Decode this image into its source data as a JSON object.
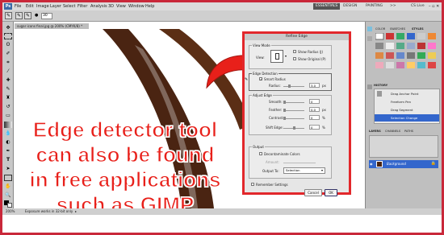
{
  "menubar": {
    "logo": "Ps",
    "items": [
      "File",
      "Edit",
      "Image",
      "Layer",
      "Select",
      "Filter",
      "Analysis",
      "3D",
      "View",
      "Window",
      "Help"
    ],
    "workspaces": [
      "ESSENTIALS",
      "DESIGN",
      "PAINTING",
      ">>"
    ],
    "cs_live": "CS Live"
  },
  "options": {
    "brush_size": "30"
  },
  "document": {
    "tab_label": "sugar icons final.jpg @ 200% (CMYK/8) *"
  },
  "status": {
    "zoom": "200%",
    "message": "Exposure works in 32-bit only"
  },
  "dialog": {
    "title": "Refine Edge",
    "view_mode": {
      "legend": "View Mode",
      "view_label": "View:",
      "show_radius": "Show Radius (J)",
      "show_original": "Show Original (P)"
    },
    "edge_detection": {
      "legend": "Edge Detection",
      "smart_radius": "Smart Radius",
      "radius_label": "Radius:",
      "radius_value": "3.0",
      "radius_unit": "px"
    },
    "adjust_edge": {
      "legend": "Adjust Edge",
      "smooth_label": "Smooth:",
      "smooth_value": "0",
      "feather_label": "Feather:",
      "feather_value": "0.0",
      "feather_unit": "px",
      "contrast_label": "Contrast:",
      "contrast_value": "0",
      "contrast_unit": "%",
      "shift_label": "Shift Edge:",
      "shift_value": "0",
      "shift_unit": "%"
    },
    "output": {
      "legend": "Output",
      "decontaminate": "Decontaminate Colors",
      "amount_label": "Amount:",
      "output_to_label": "Output To:",
      "output_to_value": "Selection"
    },
    "remember": "Remember Settings",
    "cancel": "Cancel",
    "ok": "OK"
  },
  "right_panel": {
    "top_tabs": [
      "COLOR",
      "SWATCHES",
      "STYLES"
    ],
    "history_tab": "HISTORY",
    "history_items": [
      "Drag Anchor Point",
      "Freeform Pen",
      "Drag Segment",
      "Selection Change"
    ],
    "layers_tabs": [
      "LAYERS",
      "CHANNELS",
      "PATHS"
    ],
    "layer_name": "Background"
  },
  "overlay": {
    "lines": [
      "Edge detector tool",
      "can also be found",
      "in free applications",
      "such as GIMP"
    ],
    "color": "#e8201a"
  }
}
